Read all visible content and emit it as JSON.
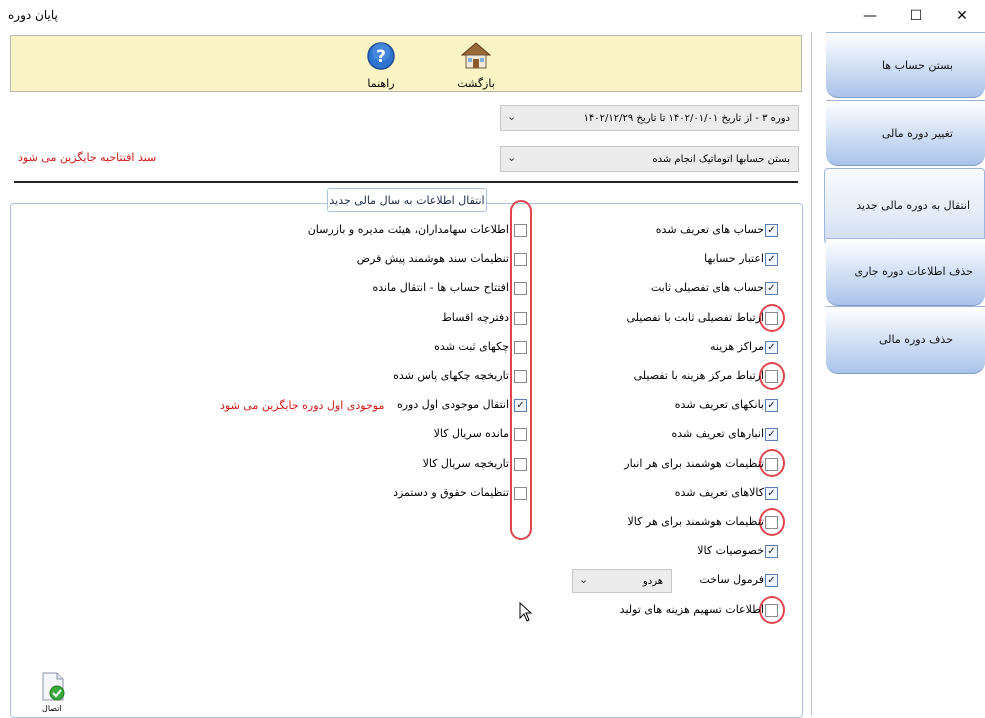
{
  "window": {
    "title": "پایان دوره",
    "minimize": "—",
    "maximize": "☐",
    "close": "✕"
  },
  "toolbar": {
    "help_label": "راهنما",
    "back_label": "بازگشت"
  },
  "period_select": {
    "value": "دوره  ۳  -  از تاریخ ۱۴۰۲/۰۱/۰۱ تا تاریخ ۱۴۰۲/۱۲/۲۹"
  },
  "status_select": {
    "value": "بستن حسابها اتوماتیک انجام شده"
  },
  "opening_note": "سند افتتاحیه جایگزین می شود",
  "group": {
    "title": "انتقال اطلاعات به سال مالی جدید"
  },
  "right_items": [
    {
      "label": "حساب های تعریف شده",
      "checked": true
    },
    {
      "label": "اعتبار حسابها",
      "checked": true
    },
    {
      "label": "حساب های تفصیلی ثابت",
      "checked": true
    },
    {
      "label": "ارتباط تفصیلی ثابت با تفصیلی",
      "checked": false
    },
    {
      "label": "مراکز هزینه",
      "checked": true
    },
    {
      "label": "ارتباط مرکز هزینه با تفصیلی",
      "checked": false
    },
    {
      "label": "بانکهای تعریف شده",
      "checked": true
    },
    {
      "label": "انبارهای تعریف شده",
      "checked": true
    },
    {
      "label": "تنظیمات هوشمند برای هر انبار",
      "checked": false
    },
    {
      "label": "کالاهای تعریف شده",
      "checked": true
    },
    {
      "label": "تنظیمات هوشمند برای هر کالا",
      "checked": false
    },
    {
      "label": "خصوصیات کالا",
      "checked": true
    },
    {
      "label": "فرمول ساخت",
      "checked": true
    },
    {
      "label": "اطلاعات تسهیم هزینه های تولید",
      "checked": false
    }
  ],
  "left_items": [
    {
      "label": "اطلاعات سهامداران، هیئت مدیره و بازرسان",
      "checked": false
    },
    {
      "label": "تنظیمات سند هوشمند پیش فرض",
      "checked": false
    },
    {
      "label": "افتتاح حساب ها - انتقال مانده",
      "checked": false
    },
    {
      "label": "دفترچه اقساط",
      "checked": false
    },
    {
      "label": "چکهای ثبت شده",
      "checked": false
    },
    {
      "label": "تاریخچه چکهای پاس شده",
      "checked": false
    },
    {
      "label": "انتقال موجودی اول دوره",
      "checked": true
    },
    {
      "label": "مانده سریال کالا",
      "checked": false
    },
    {
      "label": "تاریخچه سریال کالا",
      "checked": false
    },
    {
      "label": "تنظیمات حقوق و دستمزد",
      "checked": false
    }
  ],
  "inventory_note": "موجودی اول دوره جایگزین می شود",
  "formula_select": {
    "value": "هردو"
  },
  "sidebar": {
    "tabs": [
      {
        "label": "بستن حساب ها",
        "active": false
      },
      {
        "label": "تغییر دوره مالی",
        "active": false
      },
      {
        "label": "انتقال به دوره مالی جدید",
        "active": true
      },
      {
        "label": "حذف اطلاعات دوره جاری",
        "active": false
      },
      {
        "label": "حذف دوره مالی",
        "active": false
      }
    ]
  },
  "status_icon_label": "اتصال"
}
